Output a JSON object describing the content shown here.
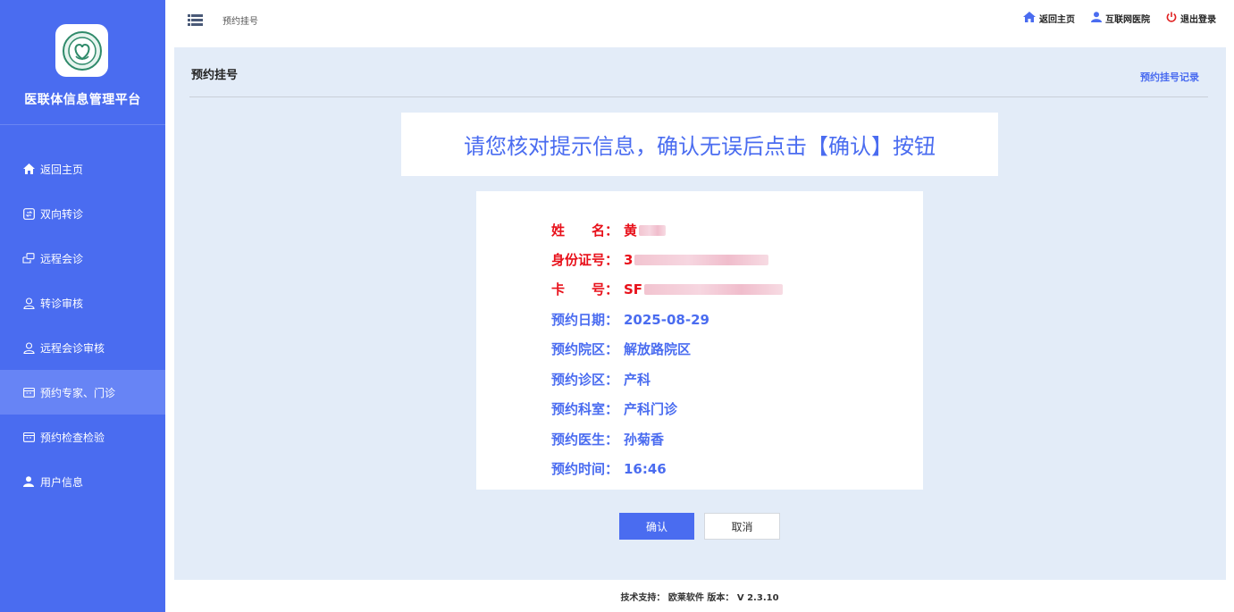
{
  "sidebar": {
    "title": "医联体信息管理平台",
    "items": [
      {
        "label": "返回主页",
        "icon": "home-icon"
      },
      {
        "label": "双向转诊",
        "icon": "referral-icon"
      },
      {
        "label": "远程会诊",
        "icon": "consultation-icon"
      },
      {
        "label": "转诊审核",
        "icon": "user-review-icon"
      },
      {
        "label": "远程会诊审核",
        "icon": "user-review-icon"
      },
      {
        "label": "预约专家、门诊",
        "icon": "calendar-icon",
        "active": true
      },
      {
        "label": "预约检查检验",
        "icon": "calendar-icon"
      },
      {
        "label": "用户信息",
        "icon": "user-icon"
      }
    ]
  },
  "topbar": {
    "breadcrumb": "预约挂号",
    "links": {
      "home": "返回主页",
      "internet_hospital": "互联网医院",
      "logout": "退出登录"
    }
  },
  "main": {
    "title": "预约挂号",
    "record_link": "预约挂号记录",
    "notice": "请您核对提示信息，确认无误后点击【确认】按钮",
    "info": {
      "name_label": "姓　　名：",
      "name_value": "黄",
      "id_label": "身份证号：",
      "id_value": "3",
      "card_label": "卡　　号：",
      "card_value": "SF",
      "date_label": "预约日期：",
      "date_value": "2025-08-29",
      "campus_label": "预约院区：",
      "campus_value": "解放路院区",
      "area_label": "预约诊区：",
      "area_value": "产科",
      "dept_label": "预约科室：",
      "dept_value": "产科门诊",
      "doctor_label": "预约医生：",
      "doctor_value": "孙菊香",
      "time_label": "预约时间：",
      "time_value": "16:46"
    },
    "confirm": "确认",
    "cancel": "取消"
  },
  "footer": "技术支持：  欧莱软件  版本：  V 2.3.10",
  "colors": {
    "primary": "#4a6cf0",
    "sidebar_active": "#6784f5",
    "main_bg": "#e3ecf8",
    "alert_red": "#e8101a",
    "logout_red": "#e02020"
  }
}
